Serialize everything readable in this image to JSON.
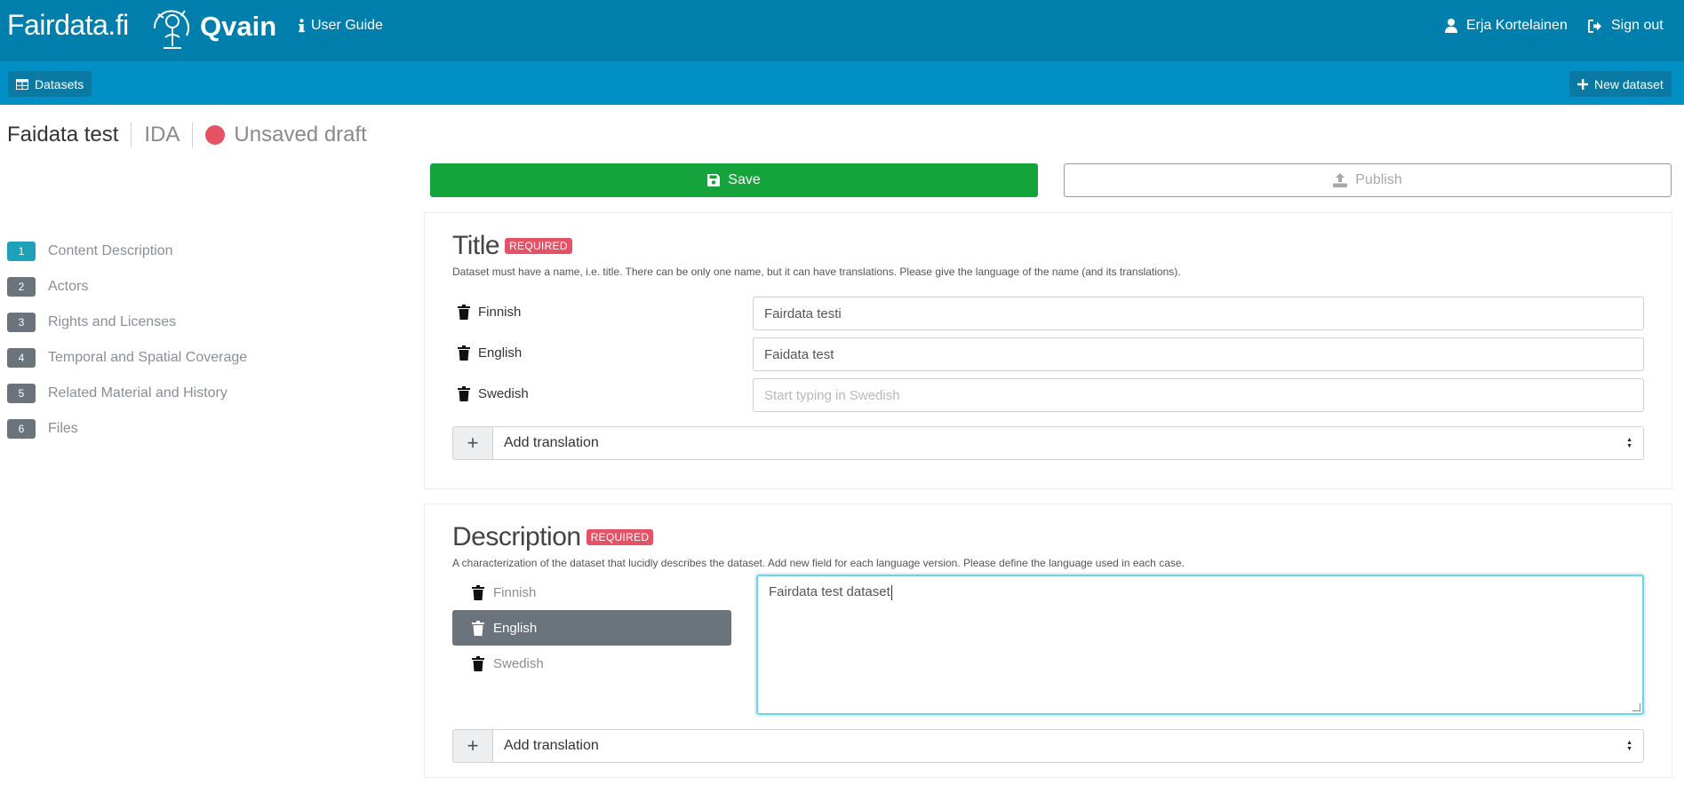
{
  "topbar": {
    "brand": "Fairdata.fi",
    "product": "Qvain",
    "user_guide": "User Guide",
    "user_name": "Erja Kortelainen",
    "sign_out": "Sign out",
    "icons": [
      "fairdata-logo-icon",
      "info-icon",
      "user-icon",
      "sign-out-icon"
    ]
  },
  "subbar": {
    "datasets_label": "Datasets",
    "new_dataset_label": "New dataset"
  },
  "status": {
    "dataset_name": "Faidata test",
    "storage": "IDA",
    "state": "Unsaved draft",
    "state_color": "#e55266"
  },
  "actions": {
    "save_label": "Save",
    "publish_label": "Publish"
  },
  "nav": {
    "items": [
      {
        "num": "1",
        "label": "Content Description",
        "active": true
      },
      {
        "num": "2",
        "label": "Actors"
      },
      {
        "num": "3",
        "label": "Rights and Licenses"
      },
      {
        "num": "4",
        "label": "Temporal and Spatial Coverage"
      },
      {
        "num": "5",
        "label": "Related Material and History"
      },
      {
        "num": "6",
        "label": "Files"
      }
    ]
  },
  "title_card": {
    "heading": "Title",
    "required": "REQUIRED",
    "help": "Dataset must have a name, i.e. title. There can be only one name, but it can have translations. Please give the language of the name (and its translations).",
    "rows": [
      {
        "lang": "Finnish",
        "value": "Fairdata testi",
        "placeholder": ""
      },
      {
        "lang": "English",
        "value": "Faidata test",
        "placeholder": ""
      },
      {
        "lang": "Swedish",
        "value": "",
        "placeholder": "Start typing in Swedish"
      }
    ],
    "add_translation": "Add translation"
  },
  "desc_card": {
    "heading": "Description",
    "required": "REQUIRED",
    "help": "A characterization of the dataset that lucidly describes the dataset. Add new field for each language version. Please define the language used in each case.",
    "langs": [
      "Finnish",
      "English",
      "Swedish"
    ],
    "active_lang": "English",
    "text": "Fairdata test dataset",
    "add_translation": "Add translation"
  },
  "colors": {
    "topbar": "#007fad",
    "subbar": "#0090c5",
    "save": "#15a43c",
    "required": "#e55266",
    "active_step": "#1fa2b8"
  }
}
